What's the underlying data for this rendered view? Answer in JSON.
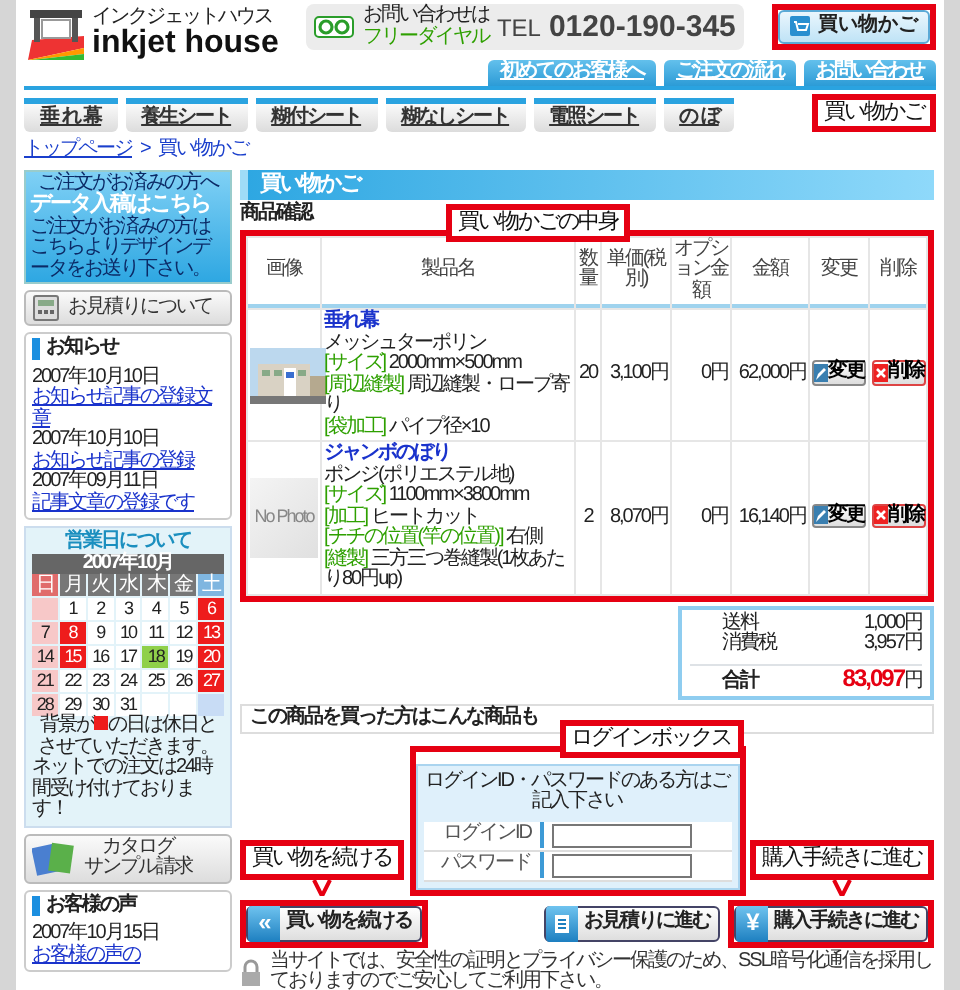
{
  "header": {
    "logo_kana": "インクジェットハウス",
    "logo_text": "inkjet house",
    "tel_caption": "お問い合わせは",
    "tel_freedial": "フリーダイヤル",
    "tel_label": "TEL",
    "tel_number": "0120-190-345",
    "cart_button": "買い物かご",
    "links": [
      "初めてのお客様へ",
      "ご注文の流れ",
      "お問い合わせ"
    ]
  },
  "nav": [
    "垂 れ 幕",
    "養生シート",
    "糊付シート",
    "糊なしシート",
    "電照シート",
    "の ぼ"
  ],
  "breadcrumb": {
    "home": "トップページ",
    "separator": ">",
    "current": "買い物かご"
  },
  "sidebar": {
    "banner": {
      "caption": "ご注文がお済みの方へ",
      "title": "データ入稿はこちら",
      "text": "ご注文がお済みの方はこちらよりデザインデータをお送り下さい。"
    },
    "estimate_link": "お見積りについて",
    "news": {
      "title": "お知らせ",
      "items": [
        {
          "date": "2007年10月10日",
          "link": "お知らせ記事の登録文章"
        },
        {
          "date": "2007年10月10日",
          "link": "お知らせ記事の登録"
        },
        {
          "date": "2007年09月11日",
          "link": "記事文章の登録です"
        }
      ]
    },
    "calendar": {
      "title": "営業日について",
      "month": "2007年10月",
      "weekdays": [
        "日",
        "月",
        "火",
        "水",
        "木",
        "金",
        "土"
      ],
      "weeks": [
        [
          {
            "kind": "blank"
          },
          {
            "day": "1",
            "kind": "normal"
          },
          {
            "day": "2",
            "kind": "normal"
          },
          {
            "day": "3",
            "kind": "normal"
          },
          {
            "day": "4",
            "kind": "normal"
          },
          {
            "day": "5",
            "kind": "normal"
          },
          {
            "day": "6",
            "kind": "holiday"
          }
        ],
        [
          {
            "day": "7",
            "kind": "normal"
          },
          {
            "day": "8",
            "kind": "holiday"
          },
          {
            "day": "9",
            "kind": "normal"
          },
          {
            "day": "10",
            "kind": "normal"
          },
          {
            "day": "11",
            "kind": "normal"
          },
          {
            "day": "12",
            "kind": "normal"
          },
          {
            "day": "13",
            "kind": "holiday"
          }
        ],
        [
          {
            "day": "14",
            "kind": "normal"
          },
          {
            "day": "15",
            "kind": "holiday"
          },
          {
            "day": "16",
            "kind": "normal"
          },
          {
            "day": "17",
            "kind": "normal"
          },
          {
            "day": "18",
            "kind": "today"
          },
          {
            "day": "19",
            "kind": "normal"
          },
          {
            "day": "20",
            "kind": "holiday"
          }
        ],
        [
          {
            "day": "21",
            "kind": "normal"
          },
          {
            "day": "22",
            "kind": "normal"
          },
          {
            "day": "23",
            "kind": "normal"
          },
          {
            "day": "24",
            "kind": "normal"
          },
          {
            "day": "25",
            "kind": "normal"
          },
          {
            "day": "26",
            "kind": "normal"
          },
          {
            "day": "27",
            "kind": "holiday"
          }
        ],
        [
          {
            "day": "28",
            "kind": "normal"
          },
          {
            "day": "29",
            "kind": "normal"
          },
          {
            "day": "30",
            "kind": "normal"
          },
          {
            "day": "31",
            "kind": "normal"
          },
          {
            "kind": "blank"
          },
          {
            "kind": "blank"
          },
          {
            "kind": "blank"
          }
        ]
      ],
      "note_before": "背景が",
      "note_after": "の日は休日とさせていただきます。",
      "note_2": "ネットでの注文は24時間受け付けております！"
    },
    "catalog": [
      "カタログ",
      "サンプル請求"
    ],
    "voice": {
      "title": "お客様の声",
      "date": "2007年10月15日",
      "link": "お客様の声の"
    }
  },
  "cart": {
    "title": "買い物かご",
    "section": "商品確認",
    "columns": [
      "画像",
      "製品名",
      "数量",
      "単価(税別)",
      "オプション金額",
      "金額",
      "変更",
      "削除"
    ],
    "rows": [
      {
        "name": "垂れ幕",
        "material": "メッシュターポリン",
        "details": [
          {
            "tag": "[サイズ]",
            "text": "2000mm×500mm"
          },
          {
            "tag": "[周辺縫製]",
            "text": "周辺縫製・ロープ寄り"
          },
          {
            "tag": "[袋加工]",
            "text": "パイプ径×10"
          }
        ],
        "qty": "20",
        "price": "3,100円",
        "option": "0円",
        "amount": "62,000円",
        "change": "変更",
        "delete": "削除"
      },
      {
        "kind": "placeholder",
        "placeholder_text": "No Photo",
        "name": "ジャンボのぼり",
        "material": "ポンジ(ポリエステル地)",
        "details": [
          {
            "tag": "[サイズ]",
            "text": "1100mm×3800mm"
          },
          {
            "tag": "[加工]",
            "text": "ヒートカット"
          },
          {
            "tag": "[チチの位置(竿の位置)]",
            "text": "右側"
          },
          {
            "tag": "[縫製]",
            "text": "三方三つ巻縫製(1枚あたり80円up)"
          }
        ],
        "qty": "2",
        "price": "8,070円",
        "option": "0円",
        "amount": "16,140円",
        "change": "変更",
        "delete": "削除"
      }
    ],
    "summary": [
      {
        "label": "送料",
        "value": "1,000円"
      },
      {
        "label": "消費税",
        "value": "3,957円"
      }
    ],
    "total": {
      "label": "合計",
      "amount": "83,097",
      "unit": "円"
    }
  },
  "related_heading": "この商品を買った方はこんな商品も",
  "login": {
    "prompt": "ログインID・パスワードのある方はご記入下さい",
    "fields": [
      {
        "label": "ログインID"
      },
      {
        "label": "パスワード"
      }
    ]
  },
  "buttons": [
    {
      "kind": "continue",
      "icon": "«",
      "label": "買い物を続ける",
      "highlighted": true
    },
    {
      "kind": "estimate",
      "label": "お見積りに進む",
      "highlighted": false
    },
    {
      "kind": "checkout",
      "icon": "¥",
      "label": "購入手続きに進む",
      "highlighted": true
    }
  ],
  "ssl_note": "当サイトでは、安全性の証明とプライバシー保護のため、SSL暗号化通信を採用しておりますのでご安心してご利用下さい。",
  "callouts": {
    "cart_button": "買い物かご",
    "cart_contents": "買い物かごの中身",
    "login_box": "ログインボックス",
    "continue": "買い物を続ける",
    "checkout": "購入手続きに進む"
  }
}
